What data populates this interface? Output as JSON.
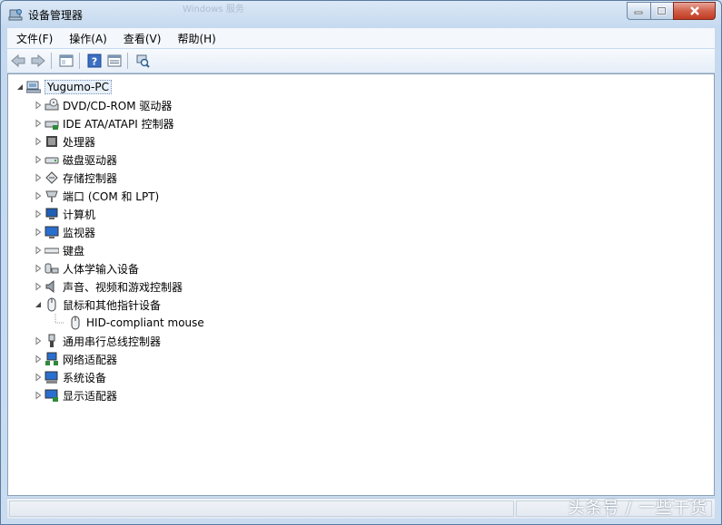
{
  "window": {
    "title": "设备管理器",
    "background_title_ghost": "Windows 服务"
  },
  "menu": [
    "文件(F)",
    "操作(A)",
    "查看(V)",
    "帮助(H)"
  ],
  "toolbar": {
    "buttons": [
      "back-icon",
      "forward-icon",
      "show-hide-console-tree-icon",
      "help-icon",
      "properties-icon",
      "scan-hardware-icon"
    ]
  },
  "tree": {
    "root": "Yugumo-PC",
    "categories": [
      "DVD/CD-ROM 驱动器",
      "IDE ATA/ATAPI 控制器",
      "处理器",
      "磁盘驱动器",
      "存储控制器",
      "端口 (COM 和 LPT)",
      "计算机",
      "监视器",
      "键盘",
      "人体学输入设备",
      "声音、视频和游戏控制器",
      "鼠标和其他指针设备",
      "通用串行总线控制器",
      "网络适配器",
      "系统设备",
      "显示适配器"
    ],
    "mouse_child": "HID-compliant mouse"
  },
  "watermark": "头条号 / 一些干货",
  "colors": {
    "frame": "#c5d9ef",
    "close_button": "#c13b22",
    "selection": "#e8f0fa"
  }
}
